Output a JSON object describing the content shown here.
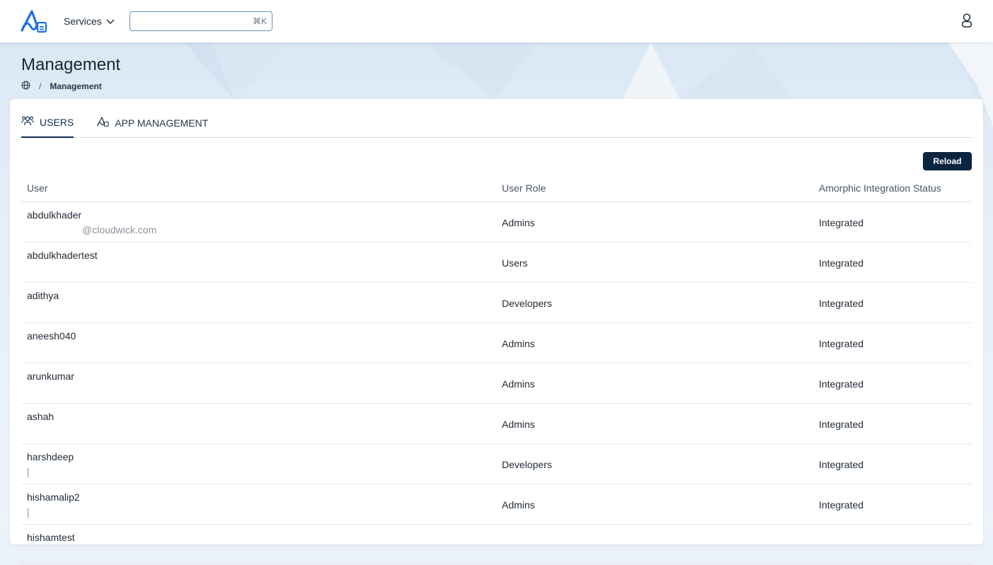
{
  "header": {
    "services_label": "Services",
    "search_placeholder": "",
    "search_shortcut": "⌘K"
  },
  "page": {
    "title": "Management",
    "breadcrumb_sep": "/",
    "breadcrumb_current": "Management"
  },
  "tabs": [
    {
      "label": "USERS",
      "active": true
    },
    {
      "label": "APP MANAGEMENT",
      "active": false
    }
  ],
  "actions": {
    "reload_label": "Reload"
  },
  "table": {
    "columns": [
      "User",
      "User Role",
      "Amorphic Integration Status"
    ],
    "rows": [
      {
        "user": "abdulkhader",
        "email": "@cloudwick.com",
        "role": "Admins",
        "status": "Integrated"
      },
      {
        "user": "abdulkhadertest",
        "email": "",
        "role": "Users",
        "status": "Integrated"
      },
      {
        "user": "adithya",
        "email": "",
        "role": "Developers",
        "status": "Integrated"
      },
      {
        "user": "aneesh040",
        "email": "",
        "role": "Admins",
        "status": "Integrated"
      },
      {
        "user": "arunkumar",
        "email": "",
        "role": "Admins",
        "status": "Integrated"
      },
      {
        "user": "ashah",
        "email": "",
        "role": "Admins",
        "status": "Integrated"
      },
      {
        "user": "harshdeep",
        "email": "|",
        "role": "Developers",
        "status": "Integrated"
      },
      {
        "user": "hishamalip2",
        "email": "|",
        "role": "Admins",
        "status": "Integrated"
      },
      {
        "user": "hishamtest",
        "email": "",
        "role": "",
        "status": ""
      }
    ]
  },
  "colors": {
    "primary": "#0b2440",
    "accent": "#1d6fe0",
    "border": "#dfe4ea"
  }
}
